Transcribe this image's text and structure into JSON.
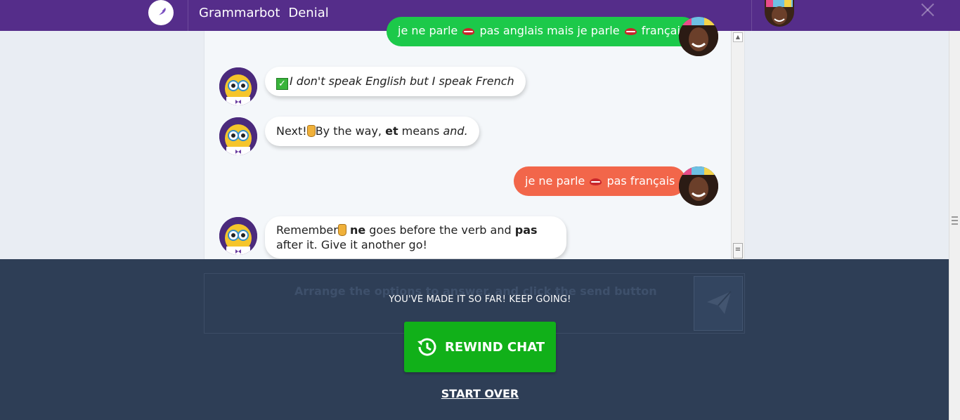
{
  "header": {
    "app_name": "Grammarbot",
    "chat_title": "Denial"
  },
  "messages": {
    "m1_user": {
      "part1": "je ne parle",
      "part2": "pas anglais mais je parle",
      "part3": "français"
    },
    "m2_bot": {
      "text": "I don't speak English but I speak French"
    },
    "m3_bot": {
      "pre": "Next!",
      "mid": "By the way, ",
      "bold": "et",
      "post": " means ",
      "italic": "and."
    },
    "m4_user": {
      "part1": "je ne parle",
      "part2": "pas français"
    },
    "m5_bot": {
      "pre": "Remember",
      "bold1": "ne",
      "mid": " goes before the verb and ",
      "bold2": "pas",
      "post": " after it. Give it another go!"
    }
  },
  "input": {
    "hint": "Arrange the options to answer, and click the send button"
  },
  "overlay": {
    "message": "YOU'VE MADE IT SO FAR! KEEP GOING!",
    "rewind_label": "REWIND CHAT",
    "start_over_label": "START OVER"
  },
  "colors": {
    "header": "#552d8a",
    "user_bubble_correct": "#1cc94a",
    "user_bubble_wrong": "#f2664a",
    "rewind_button": "#11b019",
    "overlay": "#2e3e56"
  },
  "icons": {
    "logo": "quill-icon",
    "close": "close-icon",
    "rewind": "history-icon",
    "send": "paper-plane-icon"
  }
}
